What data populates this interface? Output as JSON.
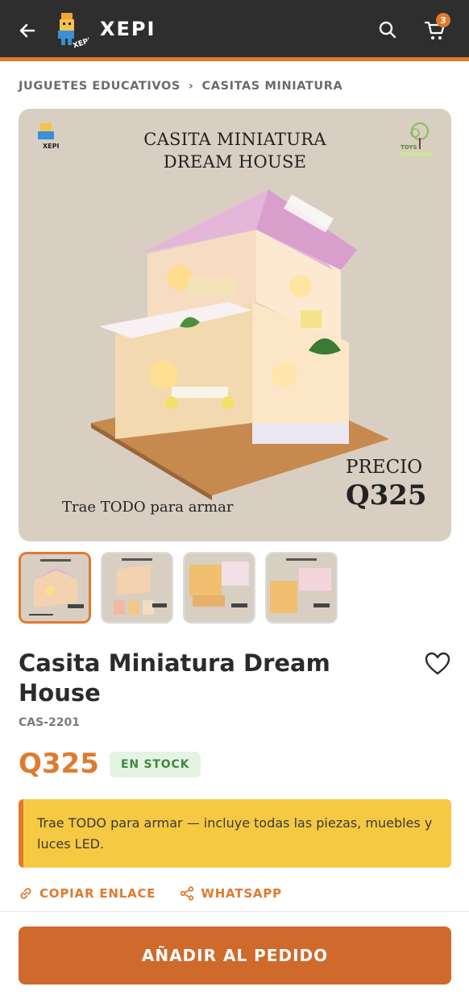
{
  "header": {
    "brand": "XEPI",
    "logo_text": "XEPI",
    "cart_count": "3",
    "icons": {
      "back": "arrow-left-icon",
      "search": "search-icon",
      "cart": "cart-icon"
    }
  },
  "breadcrumb": {
    "items": [
      "JUGUETES EDUCATIVOS",
      "CASITAS MINIATURA"
    ],
    "separator": "›"
  },
  "hero": {
    "title_line1": "CASITA MINIATURA",
    "title_line2": "DREAM HOUSE",
    "footer_text": "Trae TODO para armar",
    "price_label": "PRECIO",
    "price_value": "Q325",
    "corner_logo_text": "XEPI",
    "corner_brand_text": "TOYS"
  },
  "thumbnails": [
    {
      "selected": true
    },
    {
      "selected": false
    },
    {
      "selected": false
    },
    {
      "selected": false
    }
  ],
  "product": {
    "title": "Casita Miniatura Dream House",
    "sku": "CAS-2201",
    "price": "Q325",
    "stock_label": "EN STOCK",
    "notice": "Trae TODO para armar — incluye todas las piezas, muebles y luces LED."
  },
  "actions": {
    "copy_link": "COPIAR ENLACE",
    "whatsapp": "WHATSAPP",
    "add_to_order": "AÑADIR AL PEDIDO"
  },
  "colors": {
    "accent": "#e07a2e",
    "cta": "#cf6a2c",
    "header_bg": "#2e2e2e",
    "notice_bg": "#f6c943",
    "stock_bg": "#e5f3e3",
    "stock_text": "#3c8a3c"
  }
}
